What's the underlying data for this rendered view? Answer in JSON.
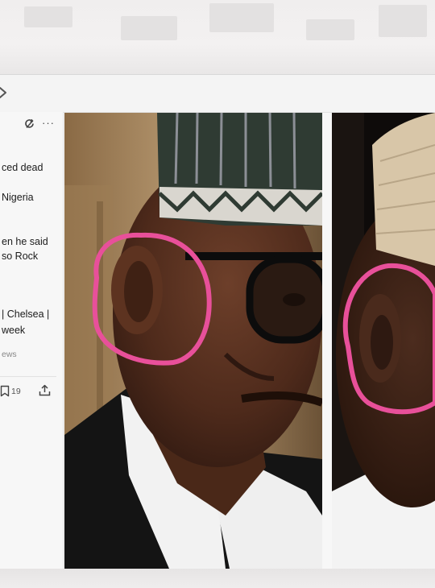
{
  "app": {
    "toolbar": {
      "back_icon": "chevron-left-icon"
    }
  },
  "left_panel": {
    "header_icons": [
      "refresh-icon",
      "more-icon"
    ],
    "more_glyph": "···",
    "snippets": [
      "ced dead",
      "Nigeria",
      "en he said",
      "so Rock",
      "| Chelsea |",
      "week"
    ],
    "source_text": "ews",
    "actions": {
      "bookmark_count": "19"
    }
  },
  "images": {
    "left": {
      "name": "photo-man-glasses-circled-ear"
    },
    "right": {
      "name": "photo-man-cap-circled-ear"
    },
    "highlight_color": "#e8509a"
  }
}
